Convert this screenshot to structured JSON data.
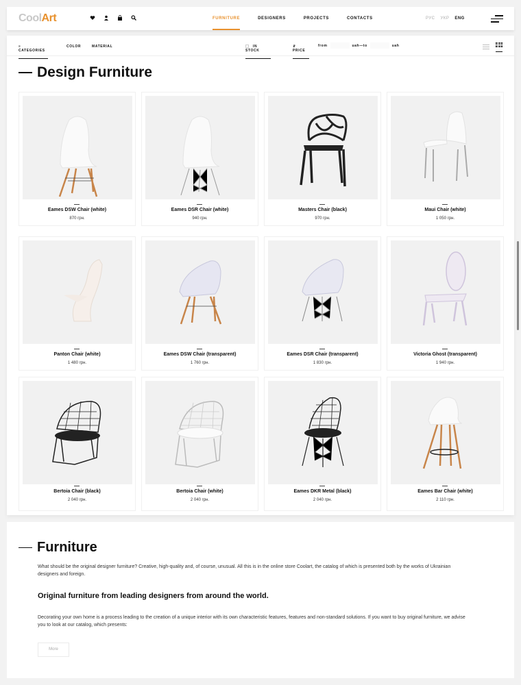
{
  "header": {
    "logo_part1": "Cool",
    "logo_part2": "Art",
    "nav": [
      "FURNITURE",
      "DESIGNERS",
      "PROJECTS",
      "CONTACTS"
    ],
    "active_nav": "FURNITURE",
    "languages": [
      "РУС",
      "УКР",
      "ENG"
    ],
    "active_language": "ENG",
    "icons": [
      "heart-icon",
      "user-icon",
      "bag-icon",
      "search-icon"
    ]
  },
  "filters": {
    "categories": "CATEGORIES",
    "color": "COLOR",
    "material": "MATERIAL",
    "in_stock": "IN STOCK",
    "price": "PRICE",
    "from": "from",
    "from_unit": "uah—to",
    "to_unit": "uah"
  },
  "catalog": {
    "title": "Design Furniture",
    "products": [
      {
        "name": "Eames DSW Chair (white)",
        "price": "870 грн."
      },
      {
        "name": "Eames DSR Chair (white)",
        "price": "940 грн."
      },
      {
        "name": "Masters Chair (black)",
        "price": "970 грн."
      },
      {
        "name": "Maui Chair (white)",
        "price": "1 050 грн."
      },
      {
        "name": "Panton Chair (white)",
        "price": "1 480 грн."
      },
      {
        "name": "Eames DSW Chair (transparent)",
        "price": "1 760 грн."
      },
      {
        "name": "Eames DSR Chair (transparent)",
        "price": "1 830 грн."
      },
      {
        "name": "Victoria Ghost (transparent)",
        "price": "1 940 грн."
      },
      {
        "name": "Bertoia Chair (black)",
        "price": "2 040 грн."
      },
      {
        "name": "Bertoia Chair (white)",
        "price": "2 040 грн."
      },
      {
        "name": "Eames DKR Metal (black)",
        "price": "2 040 грн."
      },
      {
        "name": "Eames Bar Chair (white)",
        "price": "2 110 грн."
      }
    ]
  },
  "about": {
    "title": "Furniture",
    "p1": "What should be the original designer furniture? Creative, high-quality and, of course, unusual. All this is in the online store Coolart, the catalog of which is presented both by the works of Ukrainian designers and foreign.",
    "subtitle": "Original furniture from leading designers from around the world.",
    "p2": "Decorating your own home is a process leading to the creation of a unique interior with its own characteristic features, features and non-standard solutions. If you want to buy original furniture, we advise you to look at our catalog, which presents:",
    "more_label": "More"
  },
  "colors": {
    "accent": "#e8912d",
    "text": "#111111",
    "background": "#f2f2f2"
  }
}
